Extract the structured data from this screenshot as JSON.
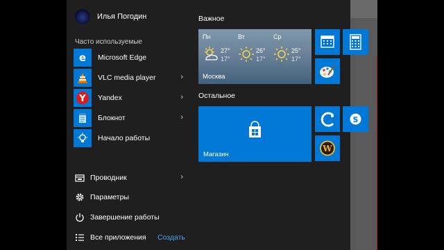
{
  "user": {
    "name": "Илья Погодин"
  },
  "frequent": {
    "label": "Часто используемые",
    "items": [
      {
        "label": "Microsoft Edge",
        "icon": "edge-icon",
        "has_arrow": false
      },
      {
        "label": "VLC media player",
        "icon": "vlc-icon",
        "has_arrow": true
      },
      {
        "label": "Yandex",
        "icon": "yandex-icon",
        "has_arrow": true
      },
      {
        "label": "Блокнот",
        "icon": "notepad-icon",
        "has_arrow": true
      },
      {
        "label": "Начало работы",
        "icon": "lightbulb-icon",
        "has_arrow": false
      }
    ]
  },
  "system": {
    "items": [
      {
        "label": "Проводник",
        "icon": "file-explorer-icon",
        "has_arrow": true
      },
      {
        "label": "Параметры",
        "icon": "gear-icon",
        "has_arrow": false
      },
      {
        "label": "Завершение работы",
        "icon": "power-icon",
        "has_arrow": false
      },
      {
        "label": "Все приложения",
        "icon": "all-apps-icon",
        "has_arrow": false
      }
    ],
    "create_label": "Создать"
  },
  "groups": [
    {
      "title": "Важное"
    },
    {
      "title": "Остальное"
    }
  ],
  "weather": {
    "city": "Москва",
    "days": [
      {
        "name": "Пн",
        "high": "27°",
        "low": "17°",
        "condition": "partly-cloudy"
      },
      {
        "name": "Вт",
        "high": "26°",
        "low": "17°",
        "condition": "sunny"
      },
      {
        "name": "Ср",
        "high": "25°",
        "low": "17°",
        "condition": "sunny"
      }
    ]
  },
  "tiles": {
    "calendar": {
      "icon": "calendar-icon"
    },
    "calculator": {
      "icon": "calculator-icon"
    },
    "paint": {
      "icon": "paint-palette-icon"
    },
    "store": {
      "label": "Магазин",
      "icon": "store-bag-icon"
    },
    "photos": {
      "icon": "photos-icon"
    },
    "skype": {
      "icon": "skype-icon"
    },
    "warcraft": {
      "icon": "warcraft-icon"
    }
  },
  "colors": {
    "accent": "#0078d7",
    "link": "#4fa3e8",
    "menu_background": "#1f1f1f"
  }
}
